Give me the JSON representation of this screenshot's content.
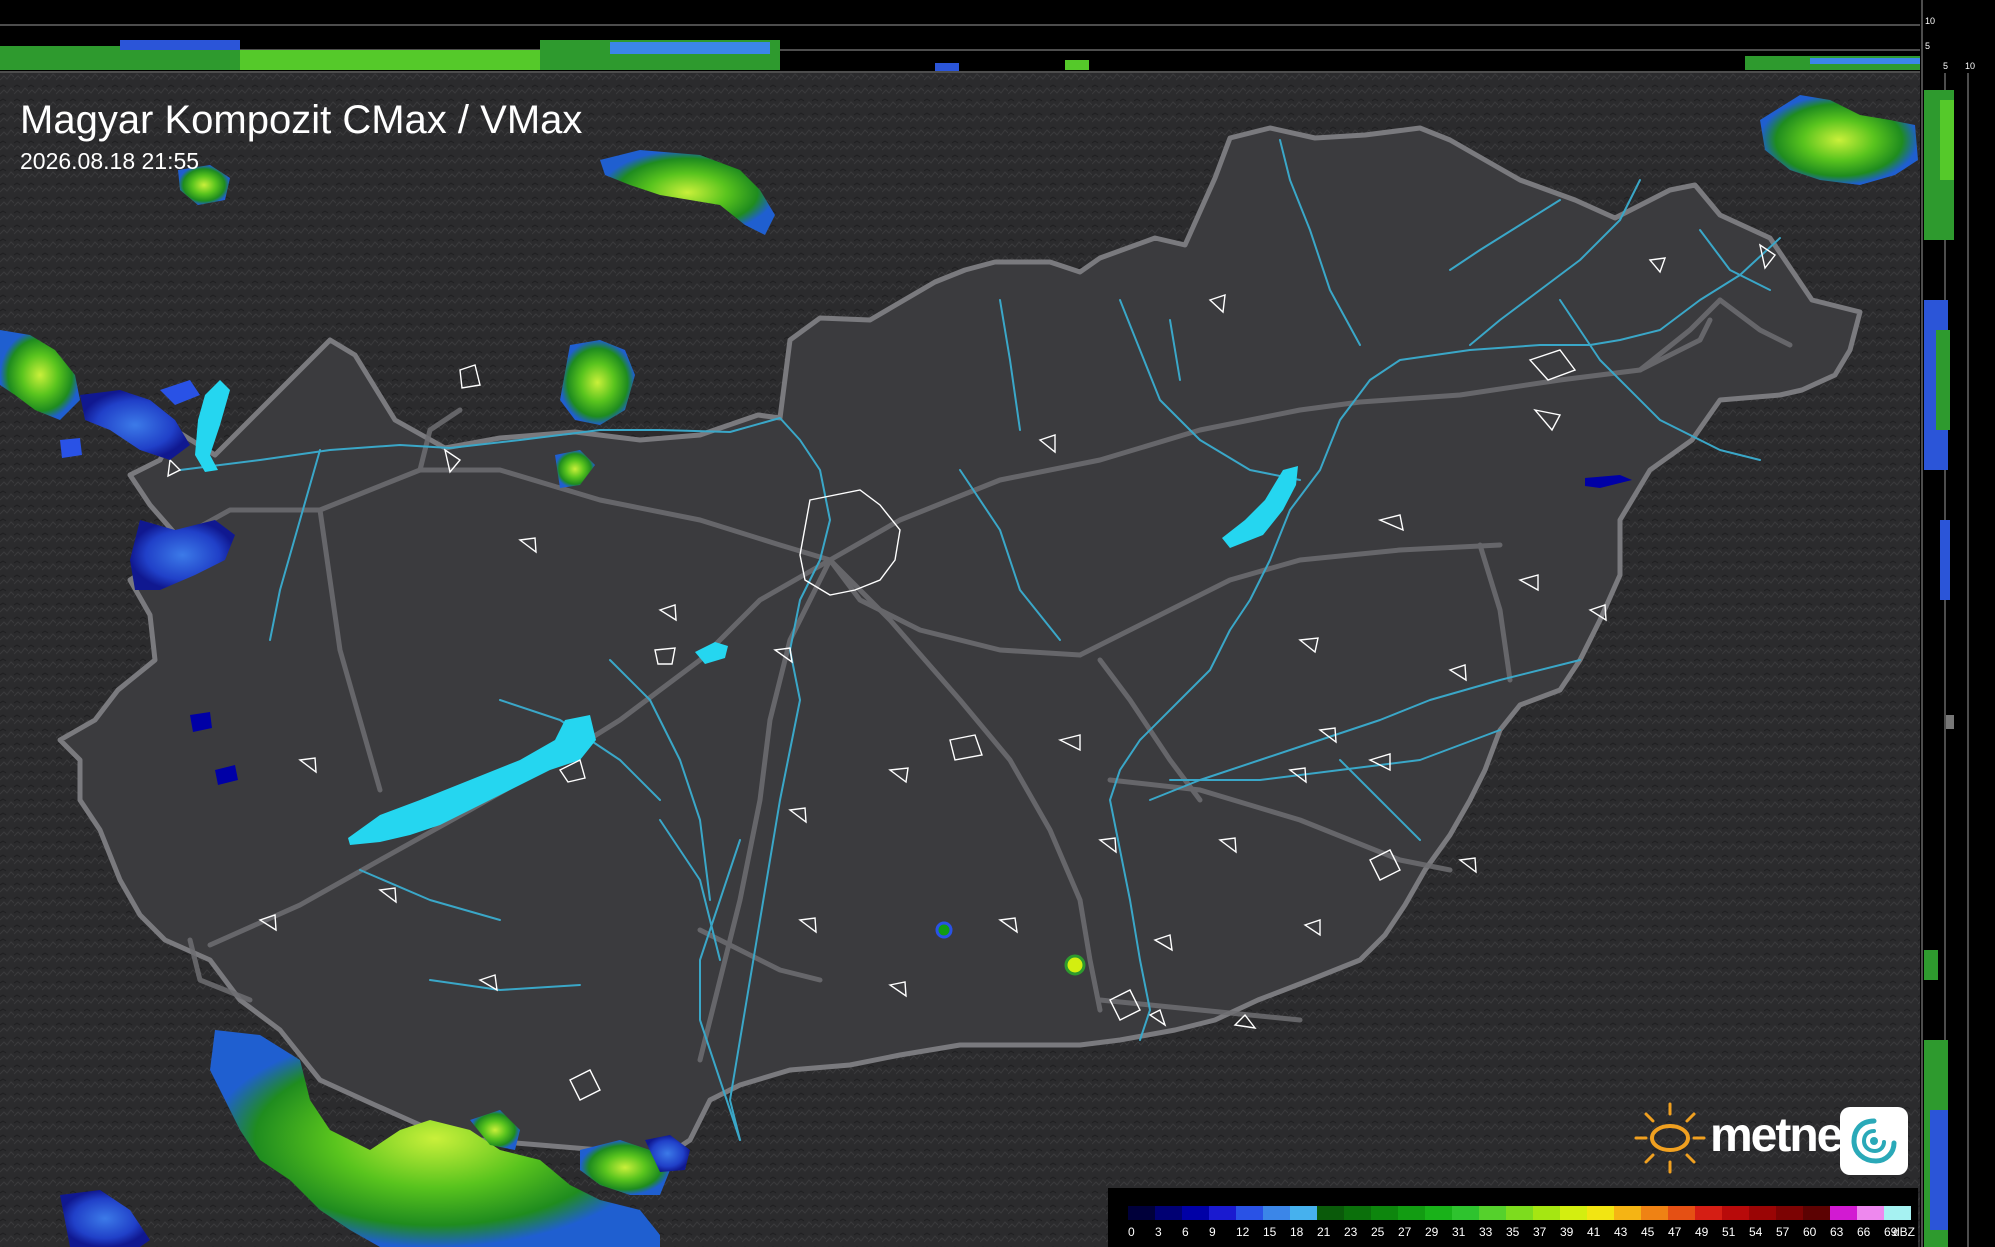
{
  "header": {
    "title": "Magyar Kompozit CMax / VMax",
    "timestamp": "2026.08.18 21:55"
  },
  "profile_labels": {
    "top_10": "10",
    "top_5": "5",
    "right_5": "5",
    "right_10": "10"
  },
  "brand": {
    "name": "metnet",
    "sun_icon": "sun-icon",
    "swirl_icon": "swirl-icon"
  },
  "legend": {
    "unit": "dBZ",
    "ticks": [
      "0",
      "3",
      "6",
      "9",
      "12",
      "15",
      "18",
      "21",
      "23",
      "25",
      "27",
      "29",
      "31",
      "33",
      "35",
      "37",
      "39",
      "41",
      "43",
      "45",
      "47",
      "49",
      "51",
      "54",
      "57",
      "60",
      "63",
      "66",
      "69"
    ],
    "colors": [
      "#00003a",
      "#000073",
      "#0000a6",
      "#1a1ad0",
      "#2952e6",
      "#3b86e8",
      "#46b1ee",
      "#0a5a0a",
      "#0b700b",
      "#0d860d",
      "#129c12",
      "#19b219",
      "#2ec32e",
      "#55d12c",
      "#7ddc1e",
      "#a5e612",
      "#d3ee10",
      "#f2e512",
      "#f5b414",
      "#ef8214",
      "#e55014",
      "#d51e14",
      "#b80a0a",
      "#9a0505",
      "#7c0303",
      "#5c0202",
      "#d21ad2",
      "#ee88ee",
      "#a6f2f2"
    ]
  },
  "colors": {
    "background": "#2b2b2d",
    "country": "#3b3b3e",
    "border": "#7a7a7e",
    "river": "#3aa7c8",
    "lake": "#25d6f0",
    "city_outline": "#ffffff",
    "road": "#6e6e72"
  }
}
